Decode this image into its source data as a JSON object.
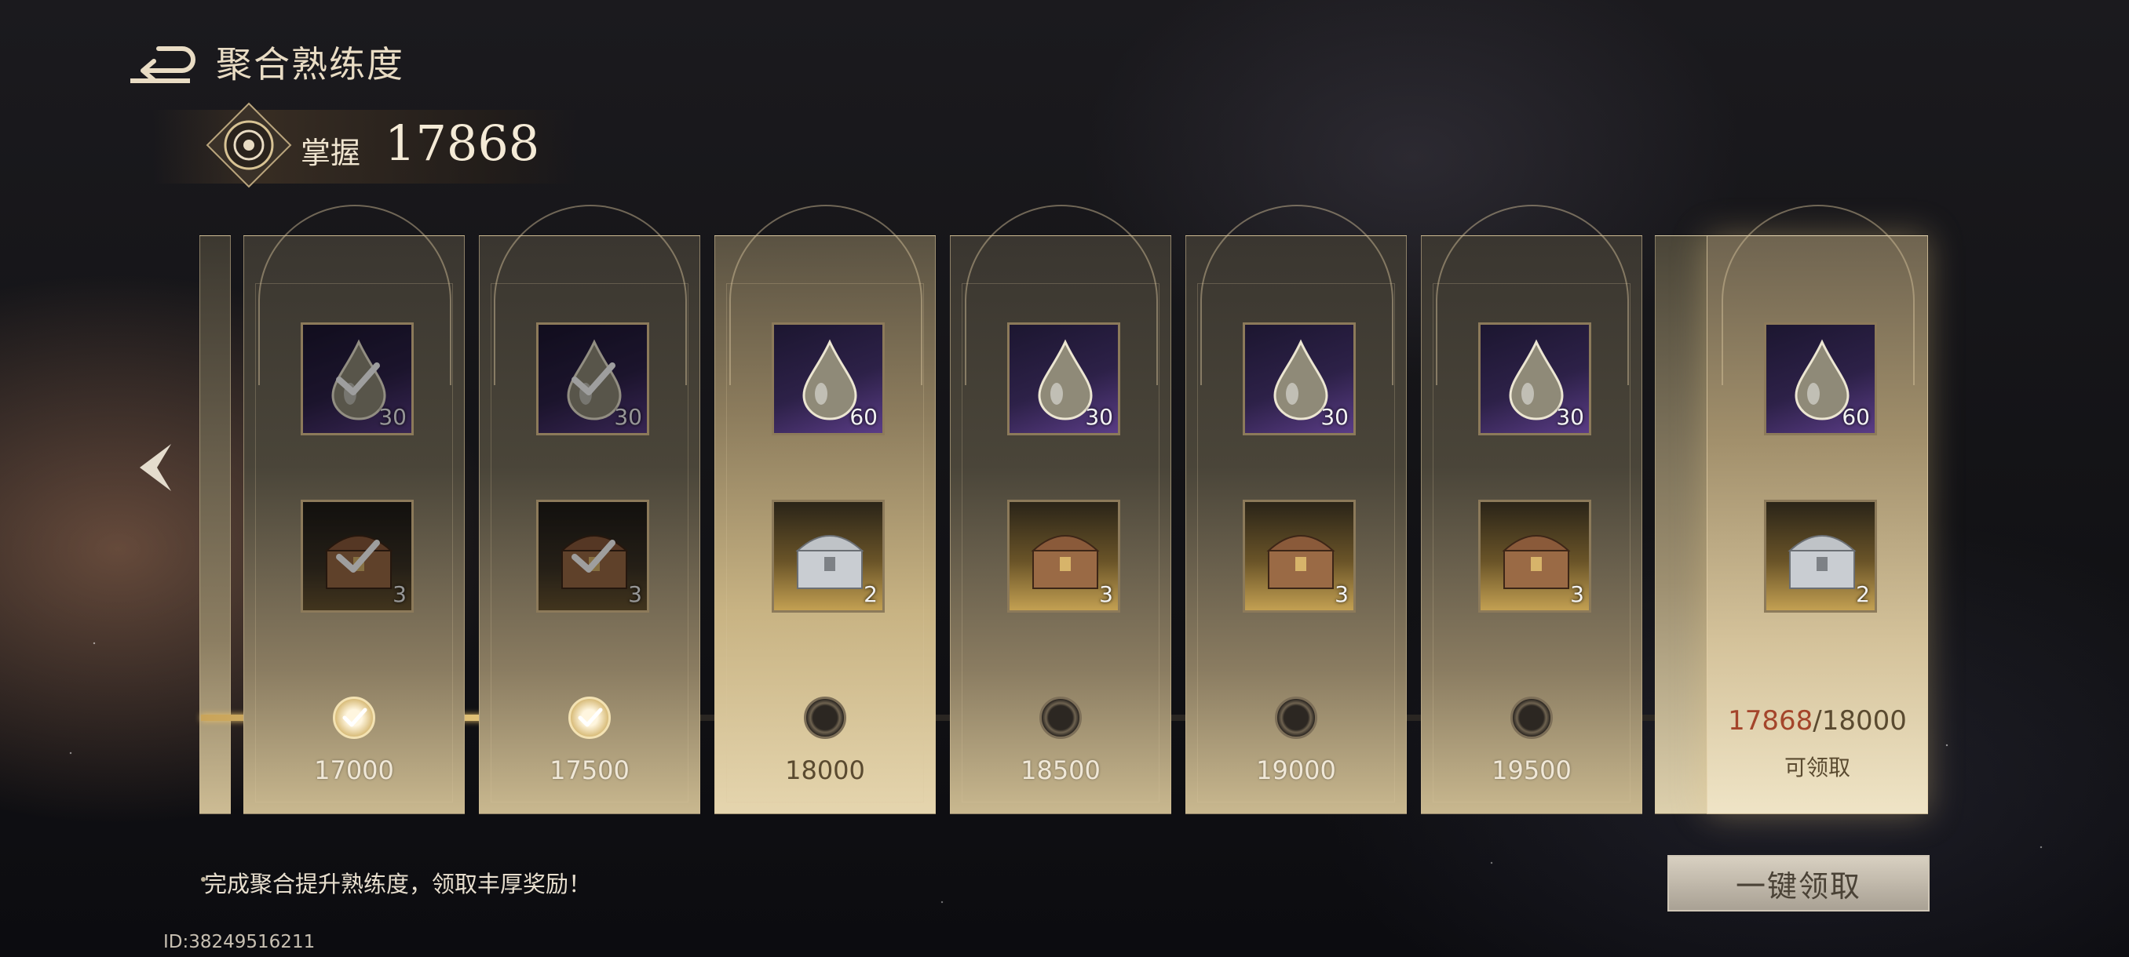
{
  "header": {
    "title": "聚合熟练度",
    "mastery_label": "掌握",
    "mastery_value": "17868"
  },
  "cards": [
    {
      "threshold": "17000",
      "drop_qty": "30",
      "chest_qty": "3",
      "claimed": true,
      "chest": "bronze"
    },
    {
      "threshold": "17500",
      "drop_qty": "30",
      "chest_qty": "3",
      "claimed": true,
      "chest": "bronze"
    },
    {
      "threshold": "18000",
      "drop_qty": "60",
      "chest_qty": "2",
      "claimed": false,
      "chest": "silver"
    },
    {
      "threshold": "18500",
      "drop_qty": "30",
      "chest_qty": "3",
      "claimed": false,
      "chest": "bronze"
    },
    {
      "threshold": "19000",
      "drop_qty": "30",
      "chest_qty": "3",
      "claimed": false,
      "chest": "bronze"
    },
    {
      "threshold": "19500",
      "drop_qty": "30",
      "chest_qty": "3",
      "claimed": false,
      "chest": "bronze"
    }
  ],
  "final_card": {
    "drop_qty": "60",
    "chest_qty": "2",
    "progress_current": "17868",
    "progress_target": "/18000",
    "status": "可领取"
  },
  "progress": {
    "fill_fraction": 0.157
  },
  "footer": {
    "hint": "完成聚合提升熟练度，领取丰厚奖励！",
    "claim_all_label": "一键领取",
    "uid": "ID:38249516211"
  },
  "colors": {
    "accent_gold": "#f3d78c",
    "progress_current": "#a4452b"
  },
  "icons": {
    "back": "back-arrow-icon",
    "mastery": "mastery-emblem-icon",
    "nav": "chevron-left-icon",
    "drop": "essence-drop-icon",
    "chest": "treasure-chest-icon",
    "check": "check-icon"
  }
}
